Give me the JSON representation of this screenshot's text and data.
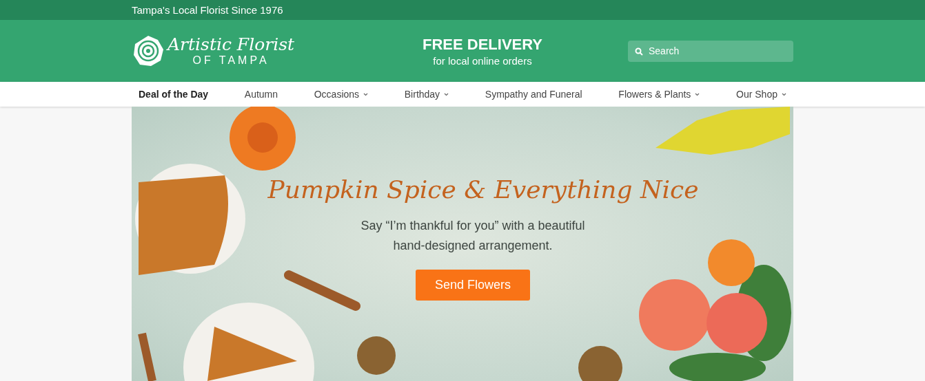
{
  "top_bar": {
    "tagline": "Tampa's Local Florist Since 1976"
  },
  "header": {
    "logo": {
      "name": "Artistic Florist",
      "subtitle": "OF TAMPA"
    },
    "promo": {
      "title": "FREE DELIVERY",
      "subtitle": "for local online orders"
    },
    "search": {
      "placeholder": "Search"
    }
  },
  "nav": [
    {
      "label": "Deal of the Day",
      "selected": true,
      "has_menu": false
    },
    {
      "label": "Autumn",
      "selected": false,
      "has_menu": false
    },
    {
      "label": "Occasions",
      "selected": false,
      "has_menu": true
    },
    {
      "label": "Birthday",
      "selected": false,
      "has_menu": true
    },
    {
      "label": "Sympathy and Funeral",
      "selected": false,
      "has_menu": false
    },
    {
      "label": "Flowers & Plants",
      "selected": false,
      "has_menu": true
    },
    {
      "label": "Our Shop",
      "selected": false,
      "has_menu": true
    }
  ],
  "hero": {
    "headline": "Pumpkin Spice & Everything Nice",
    "text": "Say “I’m thankful for you” with a beautiful hand-designed arrangement.",
    "button": "Send Flowers"
  }
}
